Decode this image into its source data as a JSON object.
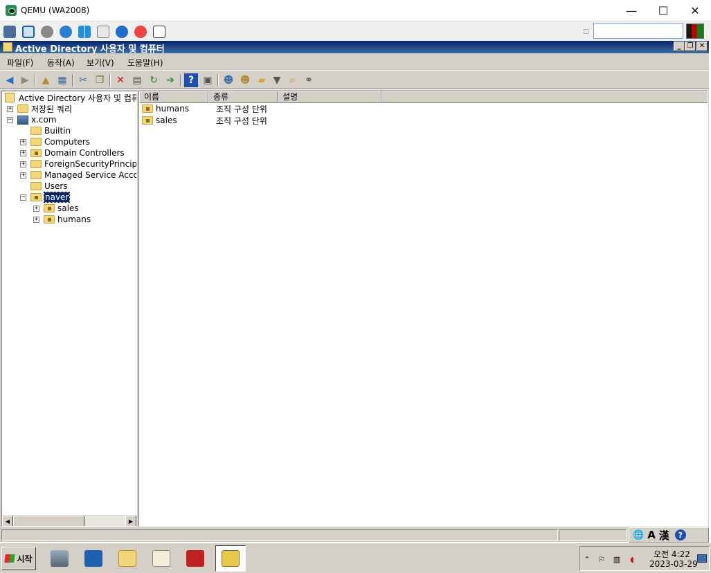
{
  "host": {
    "title": "QEMU (WA2008)",
    "controls": {
      "minimize": "—",
      "maximize": "☐",
      "close": "✕"
    },
    "toolbar_icons": [
      "stack-icon",
      "fullscreen-icon",
      "gear-icon",
      "refresh-icon",
      "windows-icon",
      "terminal-icon",
      "info-icon",
      "stop-icon",
      "floppy-icon"
    ]
  },
  "mmc": {
    "title": "Active Directory 사용자 및 컴퓨터",
    "window_buttons": {
      "minimize": "_",
      "restore": "❐",
      "close": "✕"
    },
    "menu": [
      "파일(F)",
      "동작(A)",
      "보기(V)",
      "도움말(H)"
    ],
    "toolbar_icons": [
      "back-icon",
      "forward-icon",
      "up-icon",
      "show-hide-tree-icon",
      "cut-icon",
      "copy-icon",
      "delete-icon",
      "properties-icon",
      "refresh-icon",
      "export-icon",
      "help-icon",
      "console-icon",
      "new-user-icon",
      "new-group-icon",
      "new-ou-icon",
      "filter-icon",
      "find-icon",
      "add-to-group-icon"
    ],
    "tree": {
      "root": "Active Directory 사용자 및 컴퓨터",
      "saved_queries": "저장된 쿼리",
      "domain": "x.com",
      "children": [
        {
          "label": "Builtin",
          "expandable": false
        },
        {
          "label": "Computers",
          "expandable": true
        },
        {
          "label": "Domain Controllers",
          "expandable": true
        },
        {
          "label": "ForeignSecurityPrincipals",
          "expandable": true
        },
        {
          "label": "Managed Service Accounts",
          "expandable": true
        },
        {
          "label": "Users",
          "expandable": false
        },
        {
          "label": "naver",
          "expandable": true,
          "selected": true
        }
      ],
      "naver_children": [
        "sales",
        "humans"
      ]
    },
    "list": {
      "columns": [
        "이름",
        "종류",
        "설명"
      ],
      "rows": [
        {
          "name": "humans",
          "type": "조직 구성 단위",
          "desc": ""
        },
        {
          "name": "sales",
          "type": "조직 구성 단위",
          "desc": ""
        }
      ]
    },
    "ime": {
      "globe": "🌐",
      "mode": "A",
      "hanja": "漢",
      "help": "?"
    }
  },
  "taskbar": {
    "start_label": "시작",
    "apps": [
      "server-manager-icon",
      "powershell-icon",
      "explorer-icon",
      "notepad-icon",
      "toolbox-icon",
      "ad-users-computers-icon"
    ],
    "clock_time": "오전 4:22",
    "clock_date": "2023-03-29"
  },
  "colors": {
    "mmc_titlebar": "#0a246a",
    "selection": "#0a246a",
    "chrome": "#d4d0c8"
  }
}
